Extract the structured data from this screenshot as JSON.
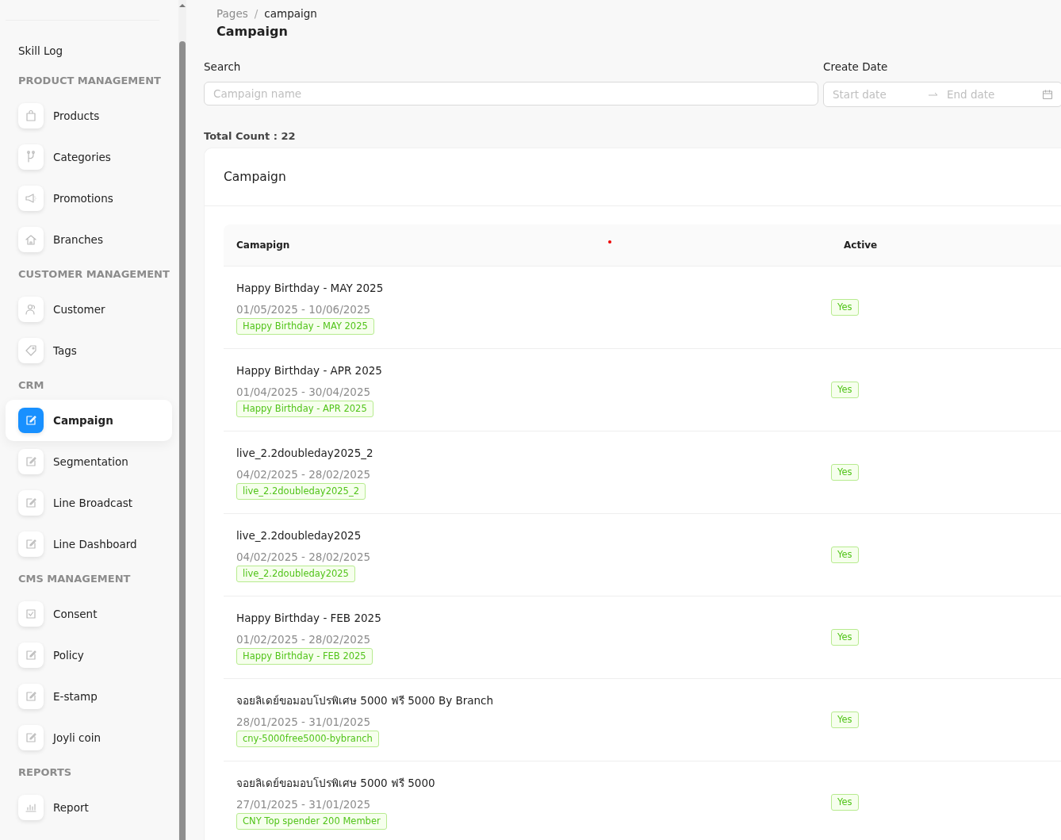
{
  "sidebar": {
    "top_items": [
      {
        "label": "Skill Log",
        "selected": false
      }
    ],
    "sections": [
      {
        "title": "PRODUCT MANAGEMENT",
        "items": [
          {
            "label": "Products",
            "selected": false
          },
          {
            "label": "Categories",
            "selected": false
          },
          {
            "label": "Promotions",
            "selected": false
          },
          {
            "label": "Branches",
            "selected": false
          }
        ]
      },
      {
        "title": "CUSTOMER MANAGEMENT",
        "items": [
          {
            "label": "Customer",
            "selected": false
          },
          {
            "label": "Tags",
            "selected": false
          }
        ]
      },
      {
        "title": "CRM",
        "items": [
          {
            "label": "Campaign",
            "selected": true
          },
          {
            "label": "Segmentation",
            "selected": false
          },
          {
            "label": "Line Broadcast",
            "selected": false
          },
          {
            "label": "Line Dashboard",
            "selected": false
          }
        ]
      },
      {
        "title": "CMS MANAGEMENT",
        "items": [
          {
            "label": "Consent",
            "selected": false
          },
          {
            "label": "Policy",
            "selected": false
          },
          {
            "label": "E-stamp",
            "selected": false
          },
          {
            "label": "Joyli coin",
            "selected": false
          }
        ]
      },
      {
        "title": "REPORTS",
        "items": [
          {
            "label": "Report",
            "selected": false
          }
        ]
      }
    ]
  },
  "breadcrumb": {
    "items": [
      "Pages",
      "campaign"
    ],
    "separator": "/"
  },
  "page_title": "Campaign",
  "filters": {
    "search": {
      "label": "Search",
      "placeholder": "Campaign name"
    },
    "create_date": {
      "label": "Create Date",
      "start_placeholder": "Start date",
      "end_placeholder": "End date"
    }
  },
  "total_count": "Total Count : 22",
  "card": {
    "title": "Campaign",
    "table": {
      "columns": [
        "Camapign",
        "Active"
      ],
      "rows": [
        {
          "name": "Happy Birthday - MAY 2025",
          "dates": "01/05/2025 - 10/06/2025",
          "tag": "Happy Birthday - MAY 2025",
          "active": "Yes"
        },
        {
          "name": "Happy Birthday - APR 2025",
          "dates": "01/04/2025 - 30/04/2025",
          "tag": "Happy Birthday - APR 2025",
          "active": "Yes"
        },
        {
          "name": "live_2.2doubleday2025_2",
          "dates": "04/02/2025 - 28/02/2025",
          "tag": "live_2.2doubleday2025_2",
          "active": "Yes"
        },
        {
          "name": "live_2.2doubleday2025",
          "dates": "04/02/2025 - 28/02/2025",
          "tag": "live_2.2doubleday2025",
          "active": "Yes"
        },
        {
          "name": "Happy Birthday - FEB 2025",
          "dates": "01/02/2025 - 28/02/2025",
          "tag": "Happy Birthday - FEB 2025",
          "active": "Yes"
        },
        {
          "name": "จอยลิเดย์ขอมอบโปรพิเศษ 5000 ฟรี 5000 By Branch",
          "dates": "28/01/2025 - 31/01/2025",
          "tag": "cny-5000free5000-bybranch",
          "active": "Yes"
        },
        {
          "name": "จอยลิเดย์ขอมอบโปรพิเศษ 5000 ฟรี 5000",
          "dates": "27/01/2025 - 31/01/2025",
          "tag": "CNY Top spender 200 Member",
          "active": "Yes"
        }
      ]
    }
  }
}
